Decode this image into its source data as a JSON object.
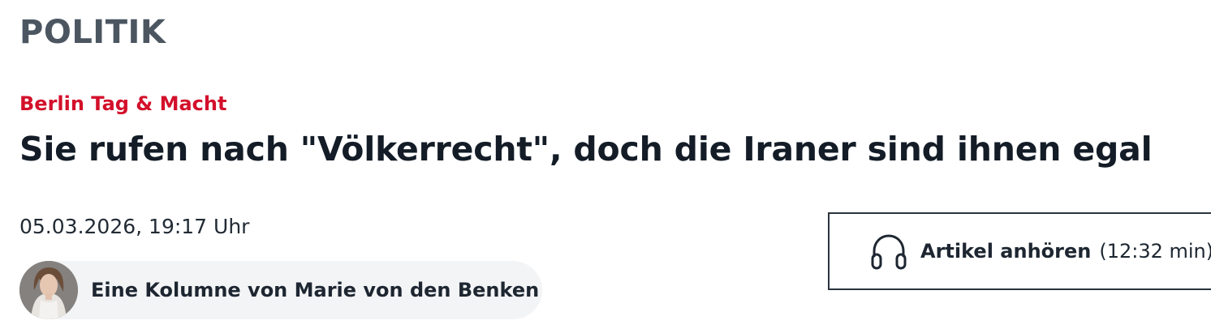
{
  "section": {
    "label": "POLITIK"
  },
  "article": {
    "kicker": "Berlin Tag & Macht",
    "headline": "Sie rufen nach \"Völkerrecht\", doch die Iraner sind ihnen egal",
    "date": "05.03.2026, 19:17 Uhr",
    "author_line": "Eine Kolumne von Marie von den Benken"
  },
  "audio": {
    "label": "Artikel anhören",
    "duration": "(12:32 min)",
    "icon": "headphones-icon"
  },
  "colors": {
    "section": "#4b5661",
    "kicker": "#d3102b",
    "headline": "#131c27",
    "pill_background": "#f3f4f6"
  }
}
